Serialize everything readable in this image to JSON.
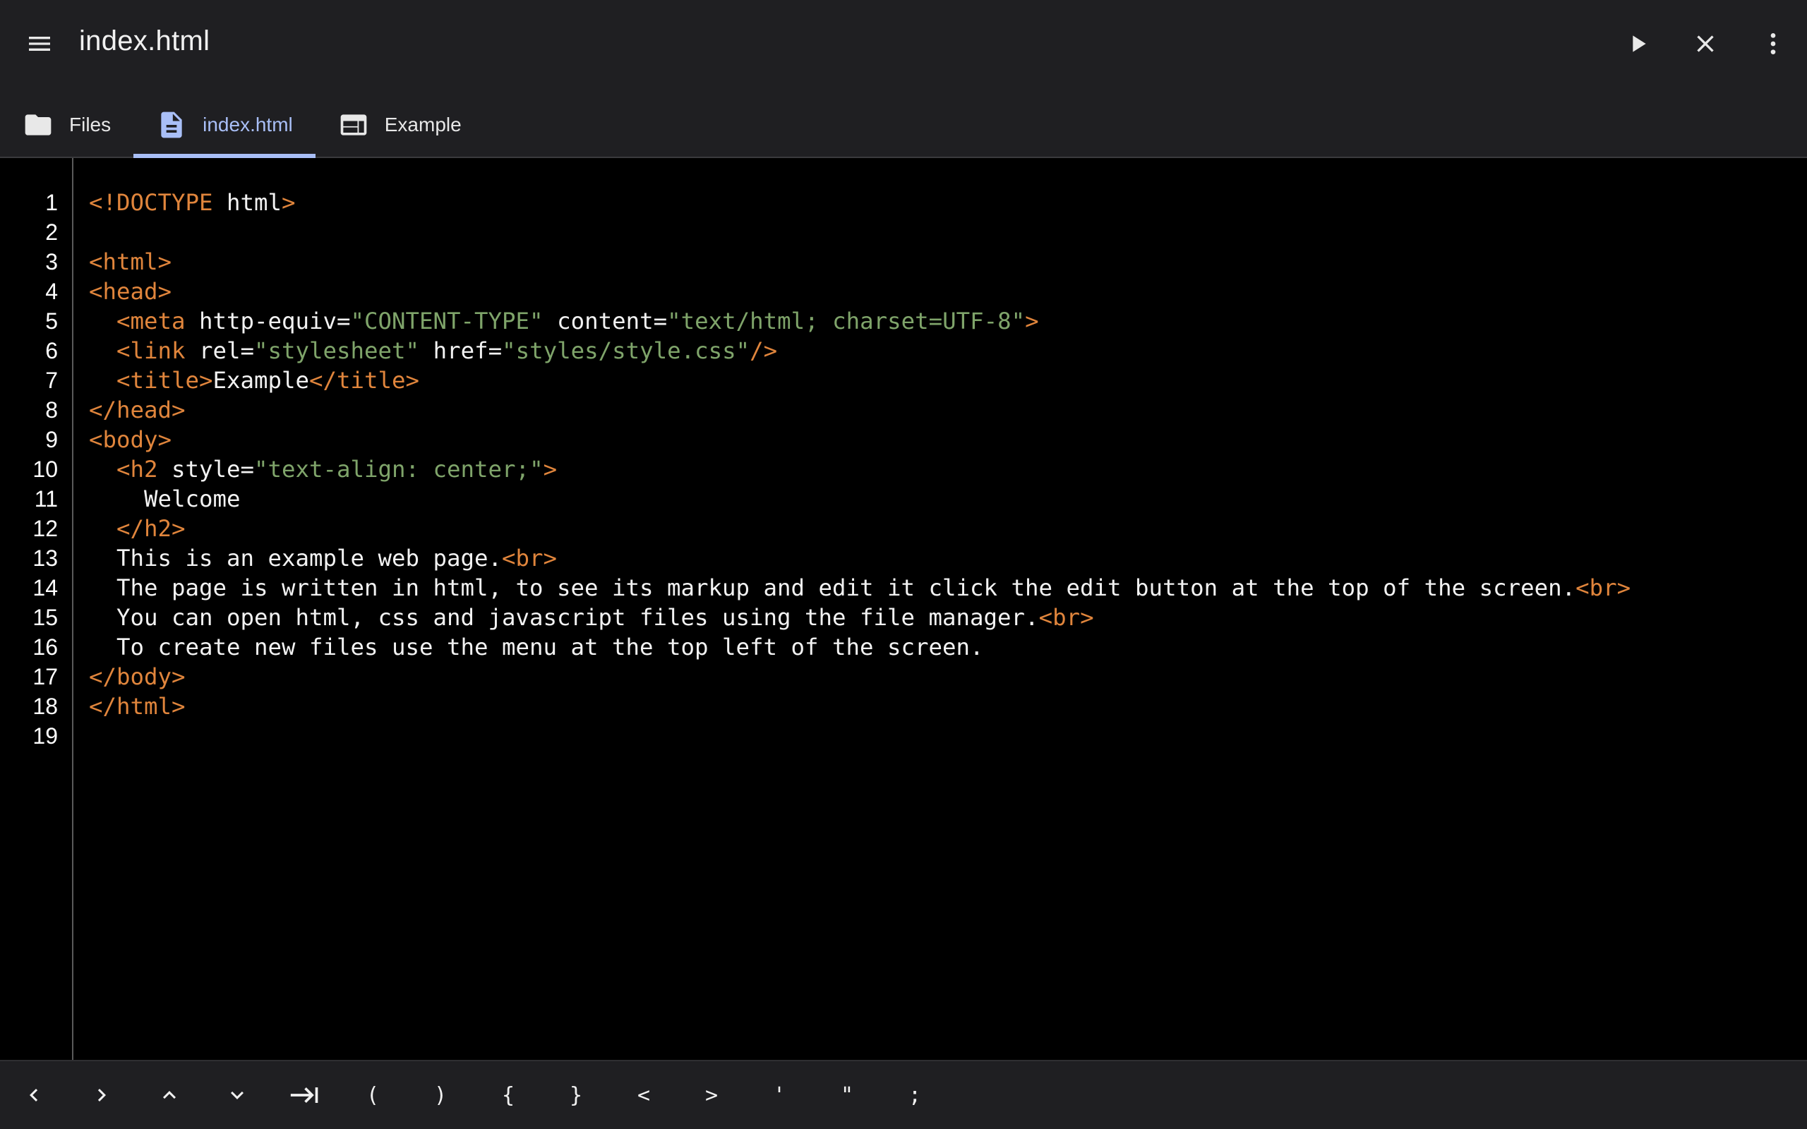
{
  "app": {
    "title": "index.html",
    "menu_icon": "hamburger-menu-icon",
    "actions": [
      {
        "name": "run-button",
        "icon": "play-icon"
      },
      {
        "name": "close-button",
        "icon": "close-icon"
      },
      {
        "name": "overflow-menu-button",
        "icon": "more-vert-icon"
      }
    ]
  },
  "tabs": [
    {
      "label": "Files",
      "icon": "folder-icon",
      "active": false
    },
    {
      "label": "index.html",
      "icon": "document-icon",
      "active": true
    },
    {
      "label": "Example",
      "icon": "web-preview-icon",
      "active": false
    }
  ],
  "editor": {
    "line_numbers": [
      "1",
      "2",
      "3",
      "4",
      "5",
      "6",
      "7",
      "8",
      "9",
      "10",
      "11",
      "12",
      "13",
      "14",
      "15",
      "16",
      "17",
      "18",
      "19"
    ],
    "lines": [
      [
        {
          "t": "tag",
          "v": "<!DOCTYPE"
        },
        {
          "t": "txt",
          "v": " html"
        },
        {
          "t": "tag",
          "v": ">"
        }
      ],
      [],
      [
        {
          "t": "tag",
          "v": "<html>"
        }
      ],
      [
        {
          "t": "tag",
          "v": "<head>"
        }
      ],
      [
        {
          "t": "txt",
          "v": "  "
        },
        {
          "t": "tag",
          "v": "<meta"
        },
        {
          "t": "attr",
          "v": " http-equiv="
        },
        {
          "t": "str",
          "v": "\"CONTENT-TYPE\""
        },
        {
          "t": "attr",
          "v": " content="
        },
        {
          "t": "str",
          "v": "\"text/html; charset=UTF-8\""
        },
        {
          "t": "tag",
          "v": ">"
        }
      ],
      [
        {
          "t": "txt",
          "v": "  "
        },
        {
          "t": "tag",
          "v": "<link"
        },
        {
          "t": "attr",
          "v": " rel="
        },
        {
          "t": "str",
          "v": "\"stylesheet\""
        },
        {
          "t": "attr",
          "v": " href="
        },
        {
          "t": "str",
          "v": "\"styles/style.css\""
        },
        {
          "t": "tag",
          "v": "/>"
        }
      ],
      [
        {
          "t": "txt",
          "v": "  "
        },
        {
          "t": "tag",
          "v": "<title>"
        },
        {
          "t": "txt",
          "v": "Example"
        },
        {
          "t": "tag",
          "v": "</title>"
        }
      ],
      [
        {
          "t": "tag",
          "v": "</head>"
        }
      ],
      [
        {
          "t": "tag",
          "v": "<body>"
        }
      ],
      [
        {
          "t": "txt",
          "v": "  "
        },
        {
          "t": "tag",
          "v": "<h2"
        },
        {
          "t": "attr",
          "v": " style="
        },
        {
          "t": "str",
          "v": "\"text-align: center;\""
        },
        {
          "t": "tag",
          "v": ">"
        }
      ],
      [
        {
          "t": "txt",
          "v": "    Welcome"
        }
      ],
      [
        {
          "t": "txt",
          "v": "  "
        },
        {
          "t": "tag",
          "v": "</h2>"
        }
      ],
      [
        {
          "t": "txt",
          "v": "  This is an example web page."
        },
        {
          "t": "tag",
          "v": "<br>"
        }
      ],
      [
        {
          "t": "txt",
          "v": "  The page is written in html, to see its markup and edit it click the edit button at the top of the screen."
        },
        {
          "t": "tag",
          "v": "<br>"
        }
      ],
      [
        {
          "t": "txt",
          "v": "  You can open html, css and javascript files using the file manager."
        },
        {
          "t": "tag",
          "v": "<br>"
        }
      ],
      [
        {
          "t": "txt",
          "v": "  To create new files use the menu at the top left of the screen."
        }
      ],
      [
        {
          "t": "tag",
          "v": "</body>"
        }
      ],
      [
        {
          "t": "tag",
          "v": "</html>"
        }
      ],
      []
    ]
  },
  "keybar": {
    "keys": [
      {
        "label": "",
        "icon": "chevron-left-icon",
        "name": "key-cursor-left"
      },
      {
        "label": "",
        "icon": "chevron-right-icon",
        "name": "key-cursor-right"
      },
      {
        "label": "",
        "icon": "chevron-up-icon",
        "name": "key-cursor-up"
      },
      {
        "label": "",
        "icon": "chevron-down-icon",
        "name": "key-cursor-down"
      },
      {
        "label": "",
        "icon": "tab-key-icon",
        "name": "key-tab"
      },
      {
        "label": "(",
        "icon": "",
        "name": "key-open-paren"
      },
      {
        "label": ")",
        "icon": "",
        "name": "key-close-paren"
      },
      {
        "label": "{",
        "icon": "",
        "name": "key-open-brace"
      },
      {
        "label": "}",
        "icon": "",
        "name": "key-close-brace"
      },
      {
        "label": "<",
        "icon": "",
        "name": "key-less-than"
      },
      {
        "label": ">",
        "icon": "",
        "name": "key-greater-than"
      },
      {
        "label": "'",
        "icon": "",
        "name": "key-single-quote"
      },
      {
        "label": "\"",
        "icon": "",
        "name": "key-double-quote"
      },
      {
        "label": ";",
        "icon": "",
        "name": "key-semicolon"
      }
    ]
  },
  "colors": {
    "tag": "#e0853c",
    "string": "#7fa46a",
    "text": "#f2f2f2",
    "accent": "#a9bff7",
    "bar_background": "#1f1f22",
    "editor_background": "#000000"
  }
}
